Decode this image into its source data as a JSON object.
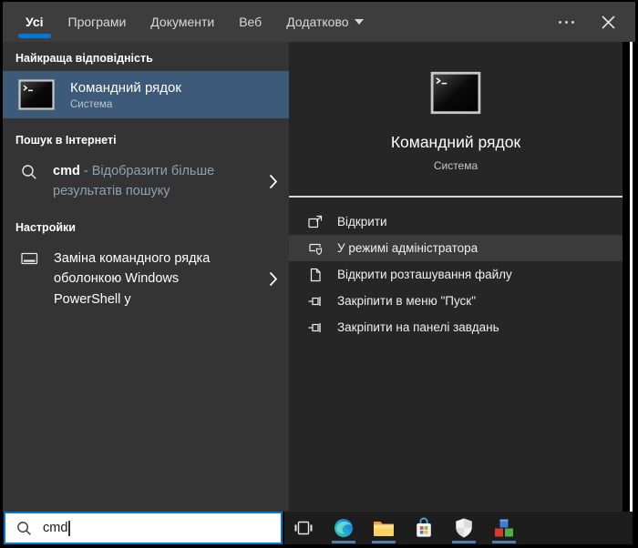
{
  "tabs": {
    "items": [
      {
        "label": "Усі",
        "active": true
      },
      {
        "label": "Програми",
        "active": false
      },
      {
        "label": "Документи",
        "active": false
      },
      {
        "label": "Веб",
        "active": false
      },
      {
        "label": "Додатково",
        "active": false,
        "has_dropdown": true
      }
    ]
  },
  "left": {
    "best_match_header": "Найкраща відповідність",
    "best_match": {
      "title": "Командний рядок",
      "subtitle": "Система"
    },
    "web_header": "Пошук в Інтернеті",
    "web_item": {
      "query": "cmd",
      "suffix": " - Відобразити більше результатів пошуку"
    },
    "settings_header": "Настройки",
    "settings_item": {
      "label": "Заміна командного рядка оболонкою Windows PowerShell у"
    }
  },
  "preview": {
    "title": "Командний рядок",
    "subtitle": "Система",
    "actions": [
      {
        "label": "Відкрити",
        "highlighted": false
      },
      {
        "label": "У режимі адміністратора",
        "highlighted": true
      },
      {
        "label": "Відкрити розташування файлу",
        "highlighted": false
      },
      {
        "label": "Закріпити в меню \"Пуск\"",
        "highlighted": false
      },
      {
        "label": "Закріпити на панелі завдань",
        "highlighted": false
      }
    ]
  },
  "search": {
    "value": "cmd"
  },
  "taskbar": {
    "items": [
      {
        "icon": "task-view-icon",
        "running": false
      },
      {
        "icon": "microsoft-edge-icon",
        "running": true
      },
      {
        "icon": "file-explorer-icon",
        "running": true
      },
      {
        "icon": "microsoft-store-icon",
        "running": false
      },
      {
        "icon": "windows-security-icon",
        "running": true
      },
      {
        "icon": "colored-blocks-app-icon",
        "running": true
      }
    ]
  },
  "colors": {
    "accent": "#0078d7",
    "topbar_bg": "#3d3d3d",
    "left_panel_bg": "#343434",
    "best_match_bg": "#3d5a78",
    "preview_bg": "#262626",
    "highlight_row_bg": "#3b3b3b",
    "taskbar_bg": "#1d1d1d",
    "running_indicator": "#4e7fb0"
  }
}
